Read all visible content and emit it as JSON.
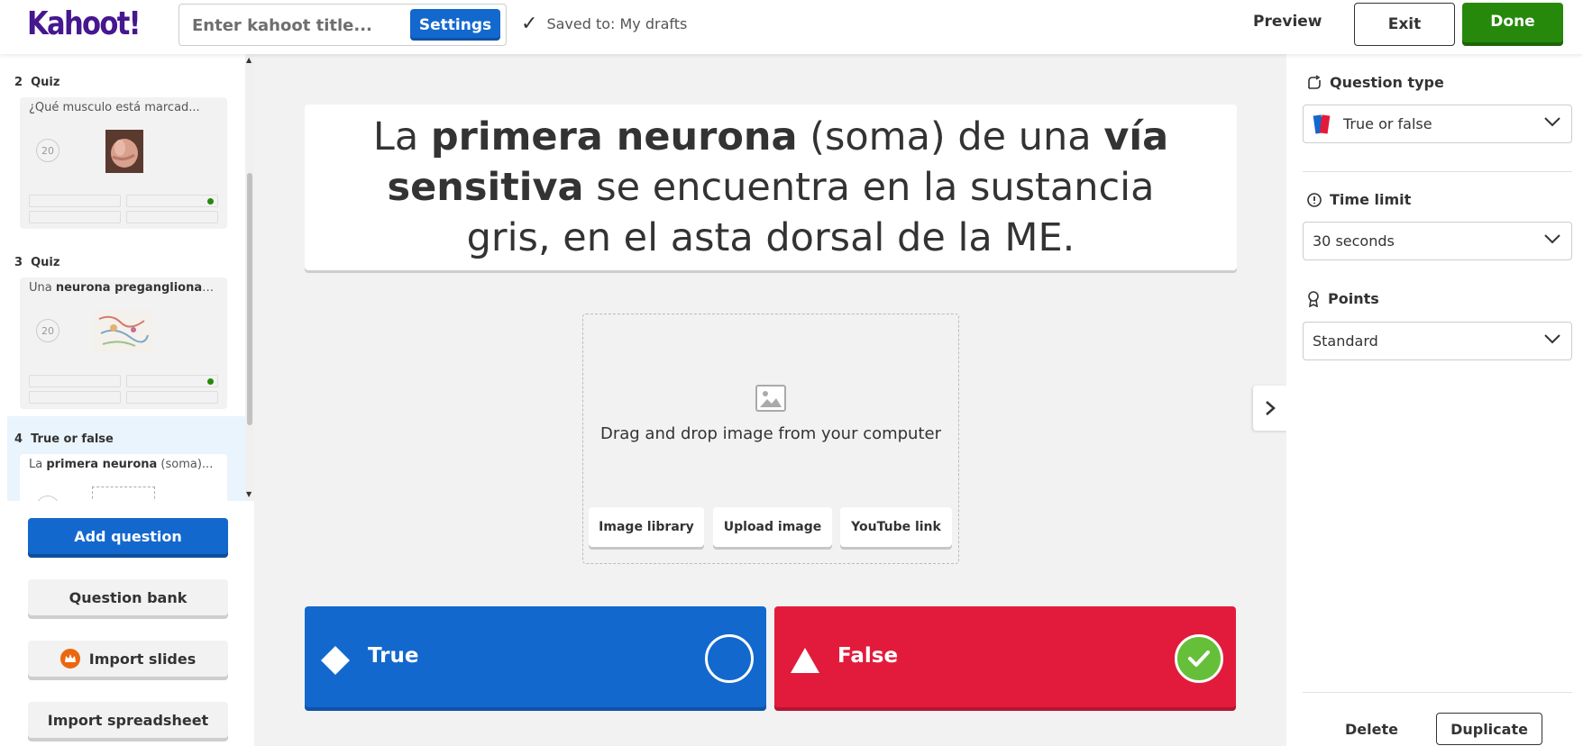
{
  "header": {
    "logo": "Kahoot!",
    "title_placeholder": "Enter kahoot title...",
    "settings_label": "Settings",
    "saved_text": "Saved to: My drafts",
    "preview_label": "Preview",
    "exit_label": "Exit",
    "done_label": "Done"
  },
  "sidebar": {
    "slides": [
      {
        "number": "2",
        "type": "Quiz",
        "question": "¿Qué musculo está marcad...",
        "time": "20",
        "correct_answer_index": 1
      },
      {
        "number": "3",
        "type": "Quiz",
        "question_prefix": "Una ",
        "question_bold": "neurona preganglionar",
        "question_suffix": "...",
        "time": "20",
        "correct_answer_index": 1
      },
      {
        "number": "4",
        "type": "True or false",
        "question_prefix": "La ",
        "question_bold": "primera neurona",
        "question_suffix": " (soma)...",
        "active": true
      }
    ],
    "buttons": {
      "add_question": "Add question",
      "question_bank": "Question bank",
      "import_slides": "Import slides",
      "import_spreadsheet": "Import spreadsheet"
    }
  },
  "question": {
    "part1": "La ",
    "bold1": "primera neurona",
    "part2": " (soma) de una ",
    "bold2": "vía sensitiva",
    "part3": " se encuentra en la sustancia gris, en el asta dorsal de la ME."
  },
  "media": {
    "drag_text": "Drag and drop image from your computer",
    "image_library": "Image library",
    "upload_image": "Upload image",
    "youtube_link": "YouTube link"
  },
  "answers": [
    {
      "label": "True",
      "shape": "diamond-icon",
      "color": "#1368ce",
      "correct": false
    },
    {
      "label": "False",
      "shape": "triangle-icon",
      "color": "#e21b3c",
      "correct": true
    }
  ],
  "settings_panel": {
    "question_type_label": "Question type",
    "question_type_value": "True or false",
    "time_limit_label": "Time limit",
    "time_limit_value": "30 seconds",
    "points_label": "Points",
    "points_value": "Standard",
    "delete_label": "Delete",
    "duplicate_label": "Duplicate"
  },
  "colors": {
    "brand": "#46178f",
    "blue": "#1368ce",
    "red": "#e21b3c",
    "green": "#26890c",
    "check_green": "#66bf39"
  }
}
